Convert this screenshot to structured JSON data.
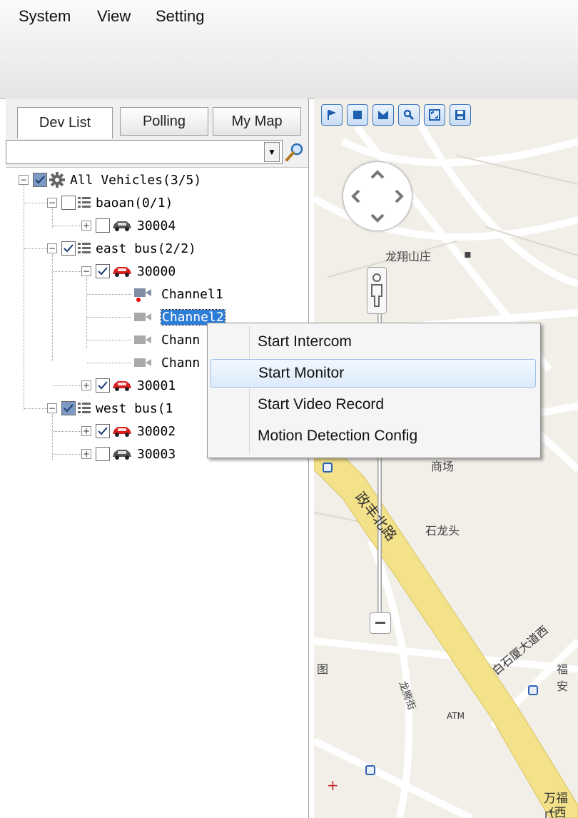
{
  "menubar": {
    "items": [
      "System",
      "View",
      "Setting"
    ]
  },
  "left_panel": {
    "tabs": [
      "Dev List",
      "Polling",
      "My Map"
    ],
    "search": {
      "value": "",
      "placeholder": ""
    },
    "tree": {
      "root": "All Vehicles(3/5)",
      "groups": [
        {
          "label": "baoan(0/1)",
          "vehicles": [
            {
              "label": "30004"
            }
          ]
        },
        {
          "label": "east bus(2/2)",
          "vehicles": [
            {
              "label": "30000",
              "channels": [
                "Channel1",
                "Channel2",
                "Chann",
                "Chann"
              ]
            },
            {
              "label": "30001"
            }
          ]
        },
        {
          "label": "west bus(1",
          "vehicles": [
            {
              "label": "30002"
            },
            {
              "label": "30003"
            }
          ]
        }
      ]
    }
  },
  "map": {
    "labels": {
      "l1": "龙翔山庄",
      "l2": "商场",
      "l3": "石龙头",
      "l4": "政丰北路",
      "l5": "白石厦大道西",
      "l6": "福安",
      "l7": "万福广",
      "l8": "(西",
      "l9": "ATM",
      "l10": "龙腾街",
      "l11": "图"
    }
  },
  "context_menu": {
    "items": [
      "Start Intercom",
      "Start Monitor",
      "Start Video Record",
      "Motion Detection Config"
    ]
  },
  "colors": {
    "selection": "#2e7dd7",
    "vehicle_on": "#d81e1e",
    "vehicle_off": "#555555",
    "road_major": "#f3e28a"
  }
}
